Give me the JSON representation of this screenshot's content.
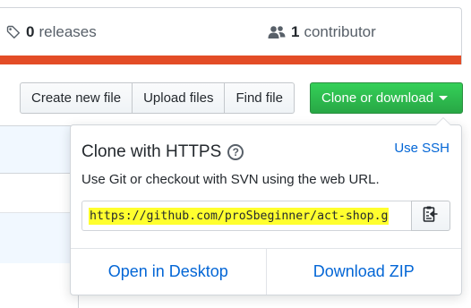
{
  "stats": {
    "releases_count": "0",
    "releases_label": "releases",
    "releases_icon": "tag-icon",
    "contributors_count": "1",
    "contributors_label": "contributor",
    "contributors_icon": "people-icon",
    "language_bar_color": "#e34c26"
  },
  "toolbar": {
    "create_new_file": "Create new file",
    "upload_files": "Upload files",
    "find_file": "Find file",
    "clone_or_download": "Clone or download"
  },
  "clone_panel": {
    "title": "Clone with HTTPS",
    "help_icon_glyph": "?",
    "use_ssh": "Use SSH",
    "description": "Use Git or checkout with SVN using the web URL.",
    "url": "https://github.com/proSbeginner/act-shop.g",
    "copy_icon": "clippy-icon",
    "open_in_desktop": "Open in Desktop",
    "download_zip": "Download ZIP"
  },
  "colors": {
    "accent_green": "#28a745",
    "link_blue": "#0366d6",
    "highlight_yellow": "#ffff2e"
  }
}
